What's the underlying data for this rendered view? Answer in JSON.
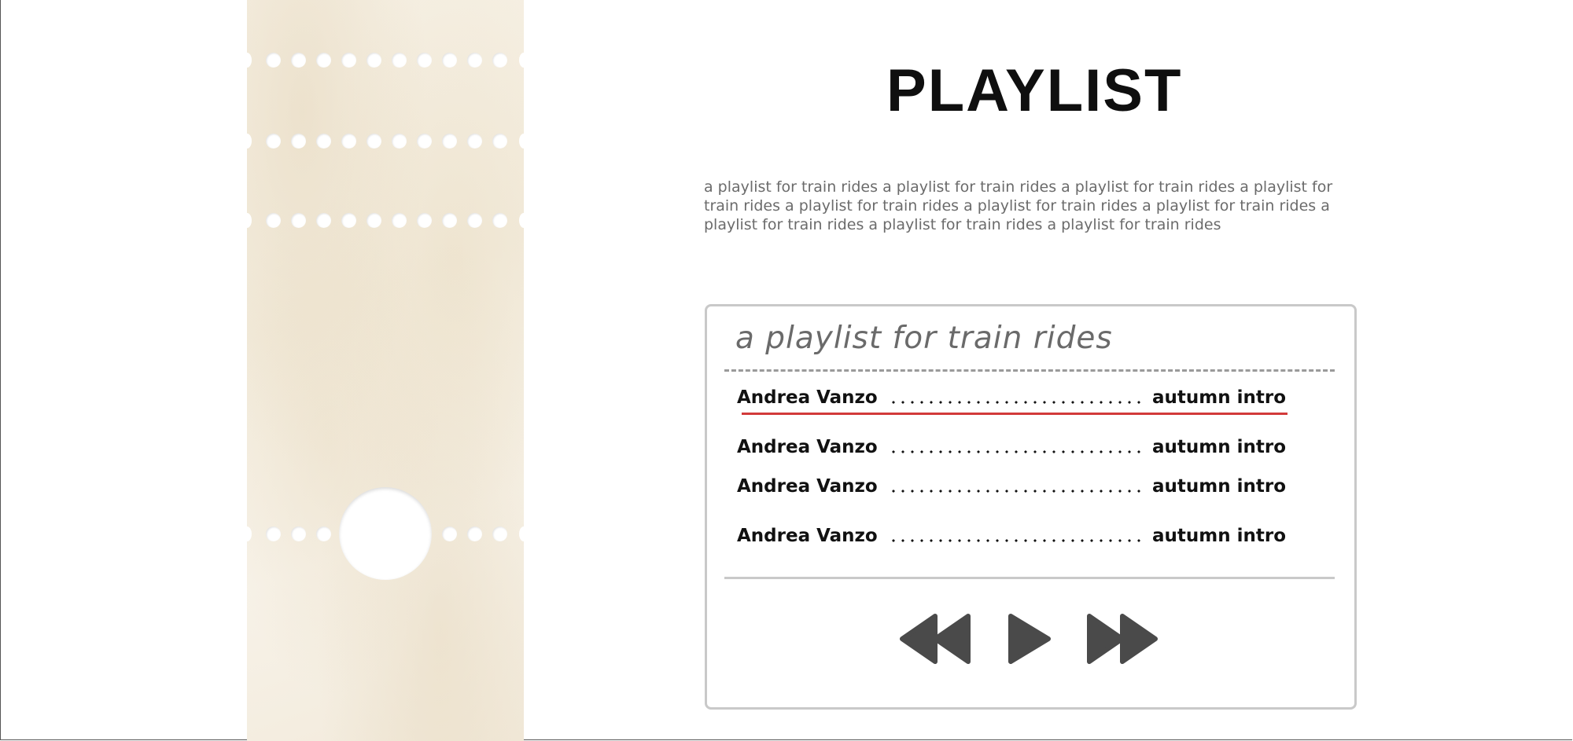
{
  "page": {
    "title": "PLAYLIST",
    "description": "a playlist for train rides a playlist for train rides a playlist for train rides a playlist for train rides a playlist for train rides a playlist for train rides a playlist for train rides a playlist for train rides a playlist for train rides a playlist for train rides"
  },
  "player": {
    "title": "a playlist for train rides",
    "tracks": [
      {
        "artist": "Andrea Vanzo",
        "song": "autumn intro",
        "active": true
      },
      {
        "artist": "Andrea Vanzo",
        "song": "autumn intro",
        "active": false
      },
      {
        "artist": "Andrea Vanzo",
        "song": "autumn intro",
        "active": false
      },
      {
        "artist": "Andrea Vanzo",
        "song": "autumn intro",
        "active": false
      }
    ],
    "controls": {
      "rewind_icon": "rewind-icon",
      "play_icon": "play-icon",
      "forward_icon": "fast-forward-icon"
    }
  },
  "colors": {
    "accent": "#d23a3a",
    "control": "#4a4a4a",
    "ticket": "#f5eee1"
  }
}
